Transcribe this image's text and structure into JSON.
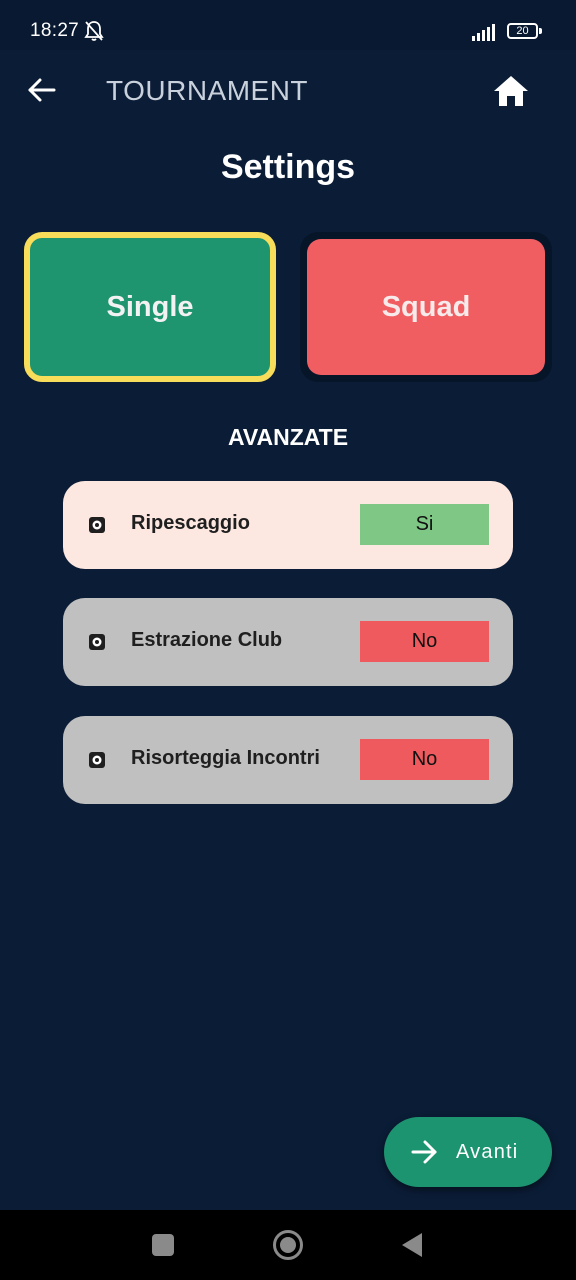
{
  "status_bar": {
    "time": "18:27",
    "battery": "20",
    "icons": [
      "bell-off-icon",
      "signal-icon",
      "battery-icon"
    ]
  },
  "app_bar": {
    "title": "TOURNAMENT",
    "back_icon": "arrow-left-icon",
    "home_icon": "home-icon"
  },
  "page": {
    "title": "Settings"
  },
  "modes": {
    "single_label": "Single",
    "squad_label": "Squad",
    "selected": "Single"
  },
  "advanced": {
    "title": "AVANZATE",
    "options": [
      {
        "label": "Ripescaggio",
        "value": "Si",
        "active": true,
        "icon": "gear-icon"
      },
      {
        "label": "Estrazione Club",
        "value": "No",
        "active": false,
        "icon": "gear-icon"
      },
      {
        "label": "Risorteggia Incontri",
        "value": "No",
        "active": false,
        "icon": "gear-icon"
      }
    ]
  },
  "fab": {
    "label": "Avanti",
    "icon": "arrow-right-icon"
  },
  "colors": {
    "background": "#0b1c36",
    "single": "#1e946f",
    "selected_border": "#f7dd5a",
    "squad": "#f05e61",
    "yes": "#7fc784",
    "no": "#ee5a5e",
    "active_card": "#fde8e1",
    "inactive_card": "#c0c0c0"
  },
  "nav_bar": {
    "icons": [
      "recents-icon",
      "home-circle-icon",
      "back-triangle-icon"
    ]
  }
}
